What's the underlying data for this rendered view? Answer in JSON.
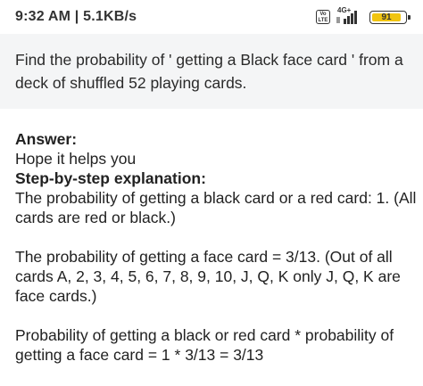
{
  "status_bar": {
    "time_speed": "9:32 AM | 5.1KB/s",
    "volte": "Vo LTE",
    "network": "4G+",
    "battery": "91"
  },
  "question": {
    "text": "Find the probability of ' getting a Black face card ' from a deck of shuffled 52 playing cards."
  },
  "answer": {
    "heading": "Answer:",
    "intro": "Hope it helps you",
    "explanation_heading": "Step-by-step explanation:",
    "paragraph1": "The probability of getting a black card or a red card: 1. (All cards are red or black.)",
    "paragraph2": "The probability of getting a face card = 3/13. (Out of all cards A, 2, 3, 4, 5, 6, 7, 8, 9, 10, J, Q, K only J, Q, K are face cards.)",
    "paragraph3": "Probability of getting a black or red card * probability of getting a face card = 1 * 3/13 = 3/13"
  }
}
